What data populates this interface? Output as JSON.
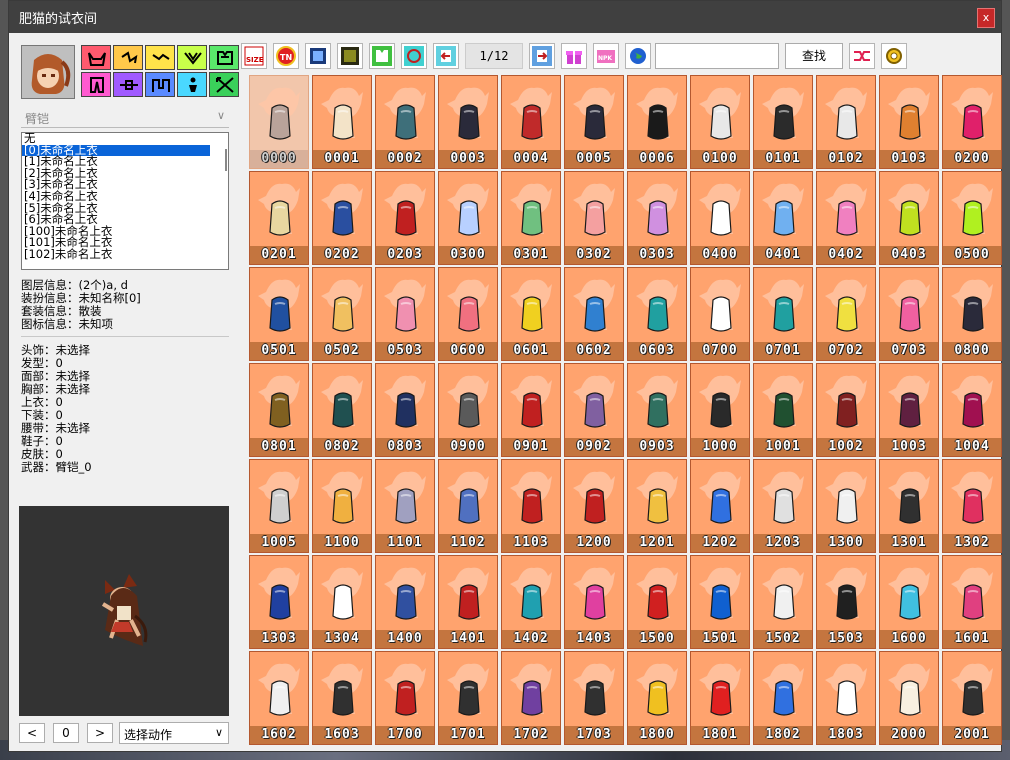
{
  "window": {
    "title": "肥猫的试衣间",
    "close_glyph": "x"
  },
  "left": {
    "part_select": "臂铠",
    "list_items": [
      "无",
      "[0]未命名上衣",
      "[1]未命名上衣",
      "[2]未命名上衣",
      "[3]未命名上衣",
      "[4]未命名上衣",
      "[5]未命名上衣",
      "[6]未命名上衣",
      "[100]未命名上衣",
      "[101]未命名上衣",
      "[102]未命名上衣"
    ],
    "selected_index": 1,
    "layer_info": "图层信息：(2个)a, d",
    "outfit_info": "装扮信息：未知名称[0]",
    "set_info": "套装信息：散装",
    "icon_info": "图标信息：未知项",
    "status": [
      "头饰：未选择",
      "发型：0",
      "面部：未选择",
      "胸部：未选择",
      "上衣：0",
      "下装：0",
      "腰带：未选择",
      "鞋子：0",
      "皮肤：0",
      "武器：臂铠_0"
    ],
    "prev": "<",
    "frame": "0",
    "next": ">",
    "action_select": "选择动作"
  },
  "toolbar": {
    "page": "1/12",
    "search_placeholder": "",
    "find_label": "查找",
    "size_label": "SIZE",
    "tn_label": "TN",
    "npk_label": "NPK"
  },
  "grid": {
    "codes": [
      "0000",
      "0001",
      "0002",
      "0003",
      "0004",
      "0005",
      "0006",
      "0100",
      "0101",
      "0102",
      "0103",
      "0200",
      "0201",
      "0202",
      "0203",
      "0300",
      "0301",
      "0302",
      "0303",
      "0400",
      "0401",
      "0402",
      "0403",
      "0500",
      "0501",
      "0502",
      "0503",
      "0600",
      "0601",
      "0602",
      "0603",
      "0700",
      "0701",
      "0702",
      "0703",
      "0800",
      "0801",
      "0802",
      "0803",
      "0900",
      "0901",
      "0902",
      "0903",
      "1000",
      "1001",
      "1002",
      "1003",
      "1004",
      "1005",
      "1100",
      "1101",
      "1102",
      "1103",
      "1200",
      "1201",
      "1202",
      "1203",
      "1300",
      "1301",
      "1302",
      "1303",
      "1304",
      "1400",
      "1401",
      "1402",
      "1403",
      "1500",
      "1501",
      "1502",
      "1503",
      "1600",
      "1601",
      "1602",
      "1603",
      "1700",
      "1701",
      "1702",
      "1703",
      "1800",
      "1801",
      "1802",
      "1803",
      "2000",
      "2001"
    ],
    "colors": [
      "#b9a39a",
      "#f3e3c8",
      "#3e6f7a",
      "#2a2a3a",
      "#c02a2a",
      "#2a2a3a",
      "#1a1a1a",
      "#e8e8e8",
      "#2b2b2b",
      "#e8e8e8",
      "#e08030",
      "#e0206a",
      "#e8d7a0",
      "#2a4fa0",
      "#c02020",
      "#b8d0ff",
      "#70c080",
      "#f4a0a0",
      "#d090e0",
      "#ffffff",
      "#70b0f0",
      "#f080c0",
      "#c0e020",
      "#b0f020",
      "#2050a0",
      "#f0c060",
      "#f090b0",
      "#f07080",
      "#f0d020",
      "#3080d0",
      "#20a0a0",
      "#ffffff",
      "#20a0a0",
      "#f0e040",
      "#f060a0",
      "#2a2a3a",
      "#806020",
      "#205050",
      "#203060",
      "#5a5a5a",
      "#c02020",
      "#8060a0",
      "#307060",
      "#2a2a2a",
      "#205030",
      "#802020",
      "#602040",
      "#a01050",
      "#cfcfcf",
      "#f0b040",
      "#a0a0c0",
      "#5070c0",
      "#c02020",
      "#c02020",
      "#f0c040",
      "#3070e0",
      "#e0e0e0",
      "#f0f0f0",
      "#303030",
      "#e03060",
      "#2040a0",
      "#ffffff",
      "#3050a0",
      "#c02020",
      "#20a0b0",
      "#e040a0",
      "#d02020",
      "#1060d0",
      "#f0f0f0",
      "#202020",
      "#40c0e0",
      "#e04080",
      "#f0f0f0",
      "#303030",
      "#c02020",
      "#303030",
      "#7040a0",
      "#303030",
      "#f0c020",
      "#e02020",
      "#3070e0",
      "#ffffff",
      "#f8f0e0",
      "#303030"
    ]
  }
}
